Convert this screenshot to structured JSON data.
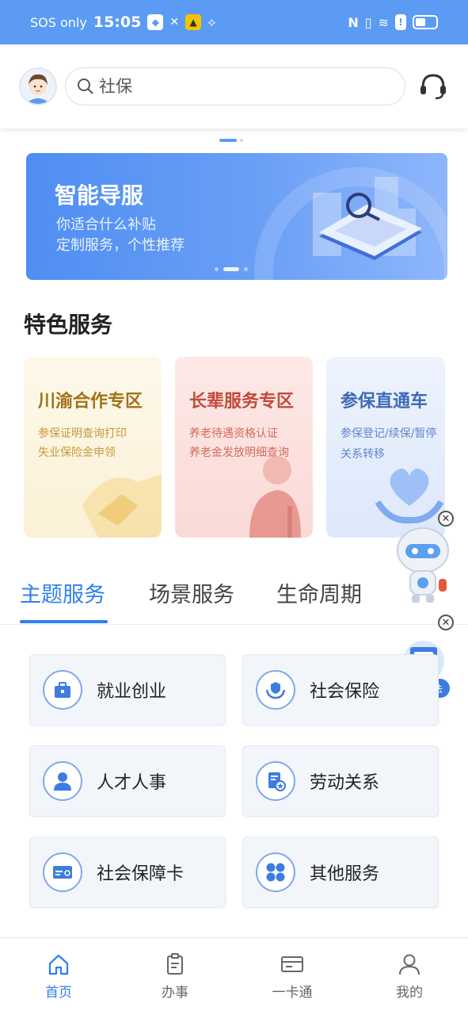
{
  "status_bar": {
    "carrier": "SOS only",
    "time": "15:05"
  },
  "header": {
    "search_placeholder": "社保"
  },
  "banner": {
    "title": "智能导服",
    "line1": "你适合什么补贴",
    "line2": "定制服务，个性推荐"
  },
  "featured": {
    "title": "特色服务",
    "cards": [
      {
        "title": "川渝合作专区",
        "lines": [
          "参保证明查询打印",
          "失业保险金申领"
        ]
      },
      {
        "title": "长辈服务专区",
        "lines": [
          "养老待遇资格认证",
          "养老金发放明细查询"
        ]
      },
      {
        "title": "参保直通车",
        "lines": [
          "参保登记/续保/暂停",
          "关系转移"
        ]
      }
    ]
  },
  "tabs": [
    {
      "label": "主题服务",
      "active": true
    },
    {
      "label": "场景服务",
      "active": false
    },
    {
      "label": "生命周期",
      "active": false
    }
  ],
  "services": [
    {
      "label": "就业创业",
      "icon": "briefcase-icon"
    },
    {
      "label": "社会保险",
      "icon": "insurance-hands-icon"
    },
    {
      "label": "人才人事",
      "icon": "person-icon"
    },
    {
      "label": "劳动关系",
      "icon": "document-star-icon"
    },
    {
      "label": "社会保障卡",
      "icon": "card-icon"
    },
    {
      "label": "其他服务",
      "icon": "grid-icon"
    }
  ],
  "floating": {
    "law_label": "精准普法"
  },
  "bottom_nav": [
    {
      "label": "首页",
      "icon": "home-icon",
      "active": true
    },
    {
      "label": "办事",
      "icon": "clipboard-icon",
      "active": false
    },
    {
      "label": "一卡通",
      "icon": "card-icon",
      "active": false
    },
    {
      "label": "我的",
      "icon": "user-icon",
      "active": false
    }
  ],
  "colors": {
    "accent": "#2f80ed",
    "status_bar": "#5b9bf4"
  }
}
